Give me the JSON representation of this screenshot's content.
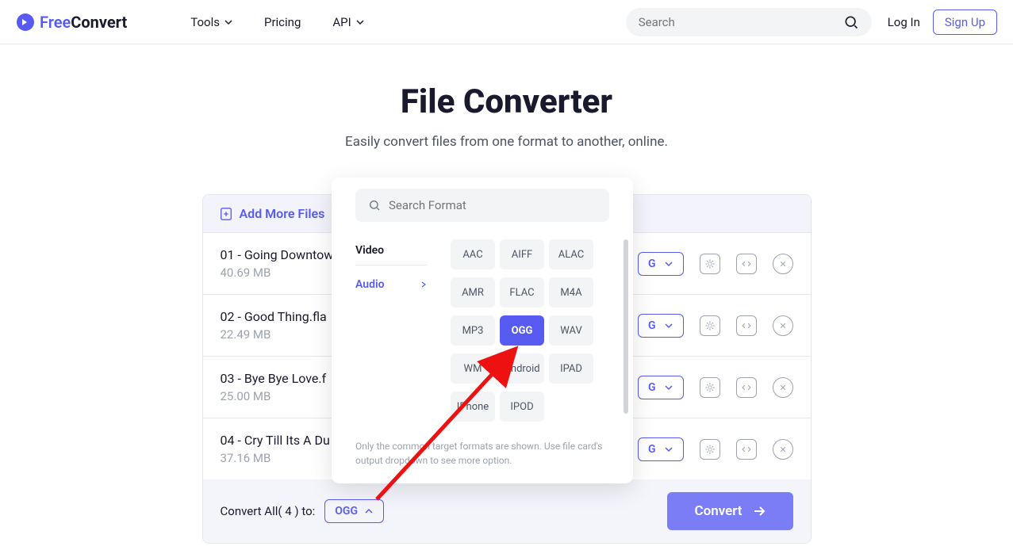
{
  "header": {
    "brand_light": "Free",
    "brand_bold": "Convert",
    "nav": {
      "tools": "Tools",
      "pricing": "Pricing",
      "api": "API"
    },
    "search_placeholder": "Search",
    "login": "Log In",
    "signup": "Sign Up"
  },
  "hero": {
    "title": "File Converter",
    "subtitle": "Easily convert files from one format to another, online."
  },
  "add_more": "Add More Files",
  "files": [
    {
      "name": "01 - Going Downtow",
      "size": "40.69 MB",
      "format": "G"
    },
    {
      "name": "02 - Good Thing.fla",
      "size": "22.49 MB",
      "format": "G"
    },
    {
      "name": "03 - Bye Bye Love.f",
      "size": "25.00 MB",
      "format": "G"
    },
    {
      "name": "04 - Cry Till Its A Du",
      "size": "37.16 MB",
      "format": "G"
    }
  ],
  "footer": {
    "label": "Convert All( 4 ) to:",
    "format": "OGG",
    "convert": "Convert"
  },
  "popup": {
    "search_placeholder": "Search Format",
    "sidebar": {
      "video": "Video",
      "audio": "Audio"
    },
    "formats": [
      "AAC",
      "AIFF",
      "ALAC",
      "AMR",
      "FLAC",
      "M4A",
      "MP3",
      "OGG",
      "WAV",
      "WM",
      "Android",
      "IPAD",
      "IPhone",
      "IPOD"
    ],
    "active_format": "OGG",
    "note": "Only the common target formats are shown. Use file card's output dropdown to see more option."
  }
}
